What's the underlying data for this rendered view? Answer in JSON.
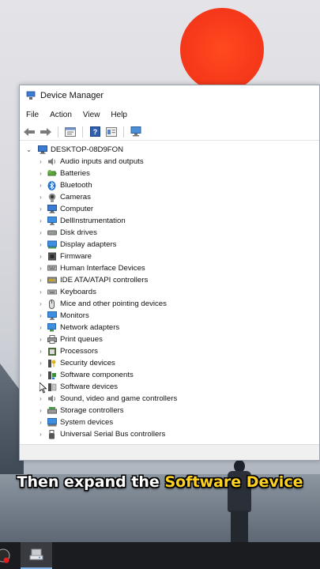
{
  "window": {
    "title": "Device Manager",
    "menu": [
      "File",
      "Action",
      "View",
      "Help"
    ],
    "toolbar_icons": [
      "back-icon",
      "forward-icon",
      "properties-icon",
      "help-icon",
      "update-driver-icon",
      "scan-hardware-icon"
    ]
  },
  "tree": {
    "root": "DESKTOP-08D9FON",
    "items": [
      {
        "label": "Audio inputs and outputs",
        "icon": "speaker-icon"
      },
      {
        "label": "Batteries",
        "icon": "battery-icon"
      },
      {
        "label": "Bluetooth",
        "icon": "bluetooth-icon"
      },
      {
        "label": "Cameras",
        "icon": "camera-icon"
      },
      {
        "label": "Computer",
        "icon": "computer-icon"
      },
      {
        "label": "DellInstrumentation",
        "icon": "monitor-icon"
      },
      {
        "label": "Disk drives",
        "icon": "disk-icon"
      },
      {
        "label": "Display adapters",
        "icon": "display-adapter-icon"
      },
      {
        "label": "Firmware",
        "icon": "firmware-icon"
      },
      {
        "label": "Human Interface Devices",
        "icon": "hid-icon"
      },
      {
        "label": "IDE ATA/ATAPI controllers",
        "icon": "ide-icon"
      },
      {
        "label": "Keyboards",
        "icon": "keyboard-icon"
      },
      {
        "label": "Mice and other pointing devices",
        "icon": "mouse-icon"
      },
      {
        "label": "Monitors",
        "icon": "monitor-icon"
      },
      {
        "label": "Network adapters",
        "icon": "network-icon"
      },
      {
        "label": "Print queues",
        "icon": "printer-icon"
      },
      {
        "label": "Processors",
        "icon": "processor-icon"
      },
      {
        "label": "Security devices",
        "icon": "security-icon"
      },
      {
        "label": "Software components",
        "icon": "software-component-icon"
      },
      {
        "label": "Software devices",
        "icon": "software-device-icon"
      },
      {
        "label": "Sound, video and game controllers",
        "icon": "speaker-icon"
      },
      {
        "label": "Storage controllers",
        "icon": "storage-icon"
      },
      {
        "label": "System devices",
        "icon": "system-icon"
      },
      {
        "label": "Universal Serial Bus controllers",
        "icon": "usb-icon"
      }
    ]
  },
  "caption": {
    "prefix": "Then expand the ",
    "highlight": "Software Device"
  },
  "colors": {
    "caption_highlight": "#ffd21f",
    "root_text": "#111111",
    "sun": "#f6391a"
  }
}
